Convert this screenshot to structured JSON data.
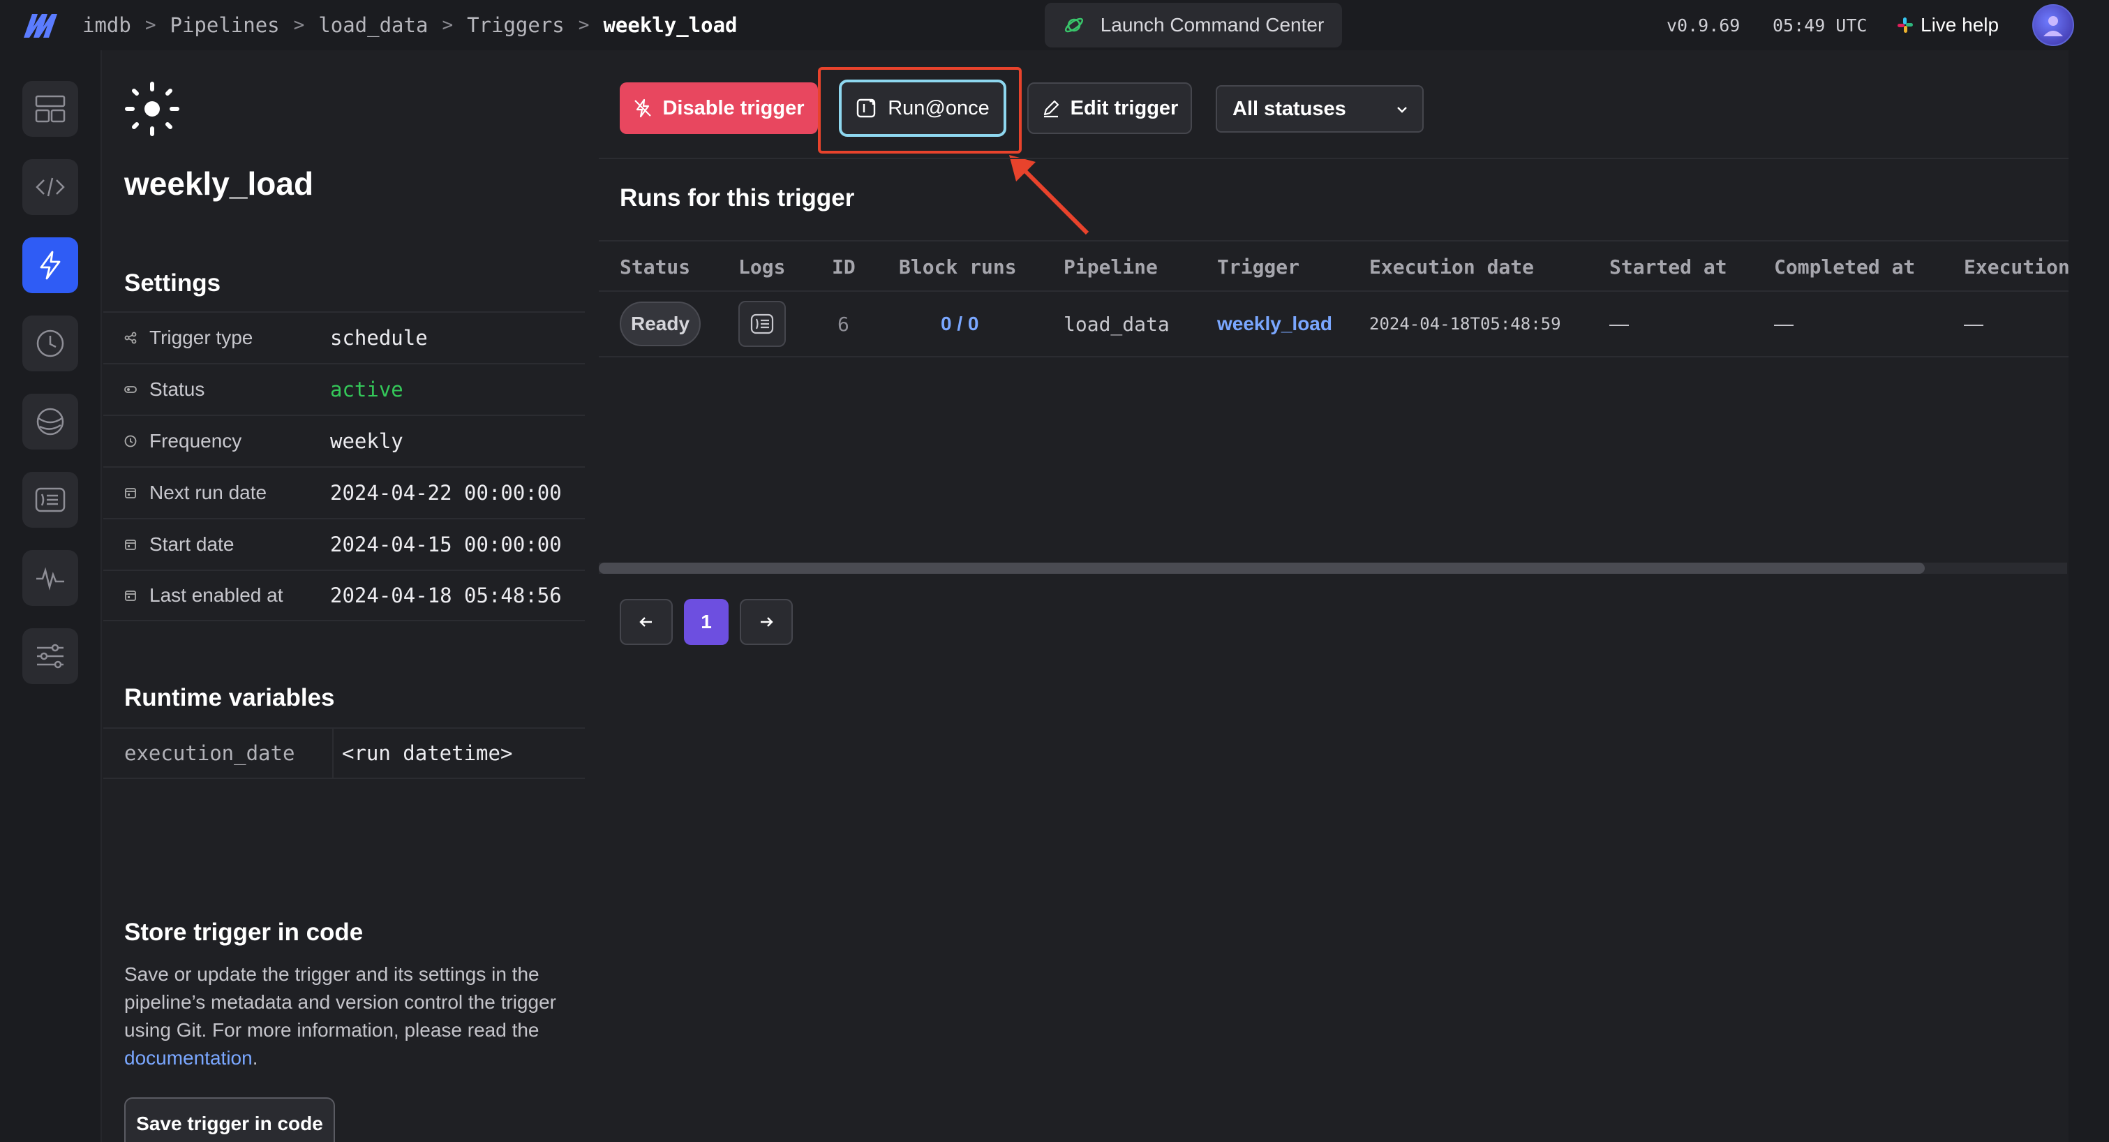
{
  "header": {
    "breadcrumb": [
      "imdb",
      "Pipelines",
      "load_data",
      "Triggers",
      "weekly_load"
    ],
    "breadcrumb_separator": ">",
    "launch_label": "Launch Command Center",
    "version": "v0.9.69",
    "time": "05:49 UTC",
    "live_help": "Live help"
  },
  "sidebar": {
    "items": [
      {
        "icon": "layout-icon",
        "active": false
      },
      {
        "icon": "code-icon",
        "active": false
      },
      {
        "icon": "lightning-icon",
        "active": true
      },
      {
        "icon": "clock-icon",
        "active": false
      },
      {
        "icon": "planet-icon",
        "active": false
      },
      {
        "icon": "terminal-icon",
        "active": false
      },
      {
        "icon": "pulse-icon",
        "active": false
      },
      {
        "icon": "sliders-icon",
        "active": false
      }
    ]
  },
  "trigger": {
    "name": "weekly_load",
    "settings_title": "Settings",
    "settings": [
      {
        "label": "Trigger type",
        "value": "schedule",
        "icon": "share-icon"
      },
      {
        "label": "Status",
        "value": "active",
        "icon": "toggle-icon"
      },
      {
        "label": "Frequency",
        "value": "weekly",
        "icon": "clock-icon"
      },
      {
        "label": "Next run date",
        "value": "2024-04-22 00:00:00",
        "icon": "calendar-icon"
      },
      {
        "label": "Start date",
        "value": "2024-04-15 00:00:00",
        "icon": "calendar-icon"
      },
      {
        "label": "Last enabled at",
        "value": "2024-04-18 05:48:56",
        "icon": "calendar-icon"
      }
    ],
    "runtime_title": "Runtime variables",
    "runtime_variables": [
      {
        "key": "execution_date",
        "value": "<run datetime>"
      }
    ],
    "store_title": "Store trigger in code",
    "store_desc": "Save or update the trigger and its settings in the pipeline’s metadata and version control the trigger using Git. For more information, please read the ",
    "store_link": "documentation",
    "store_period": ".",
    "save_button": "Save trigger in code"
  },
  "toolbar": {
    "disable_label": "Disable trigger",
    "run_once_label": "Run@once",
    "edit_label": "Edit trigger",
    "status_filter": "All statuses"
  },
  "runs": {
    "title": "Runs for this trigger",
    "columns": [
      "Status",
      "Logs",
      "ID",
      "Block runs",
      "Pipeline",
      "Trigger",
      "Execution date",
      "Started at",
      "Completed at",
      "Execution"
    ],
    "rows": [
      {
        "status": "Ready",
        "id": "6",
        "block_runs": "0 / 0",
        "pipeline": "load_data",
        "trigger": "weekly_load",
        "execution_date": "2024-04-18T05:48:59",
        "started_at": "—",
        "completed_at": "—",
        "execution": "—"
      }
    ]
  },
  "pagination": {
    "current_page": "1"
  },
  "colors": {
    "accent": "#2f5cf5",
    "danger": "#e8475f",
    "active_status": "#34c759",
    "link": "#7aa7ff",
    "highlight": "#e8432c",
    "page": "#6d4fe0"
  }
}
